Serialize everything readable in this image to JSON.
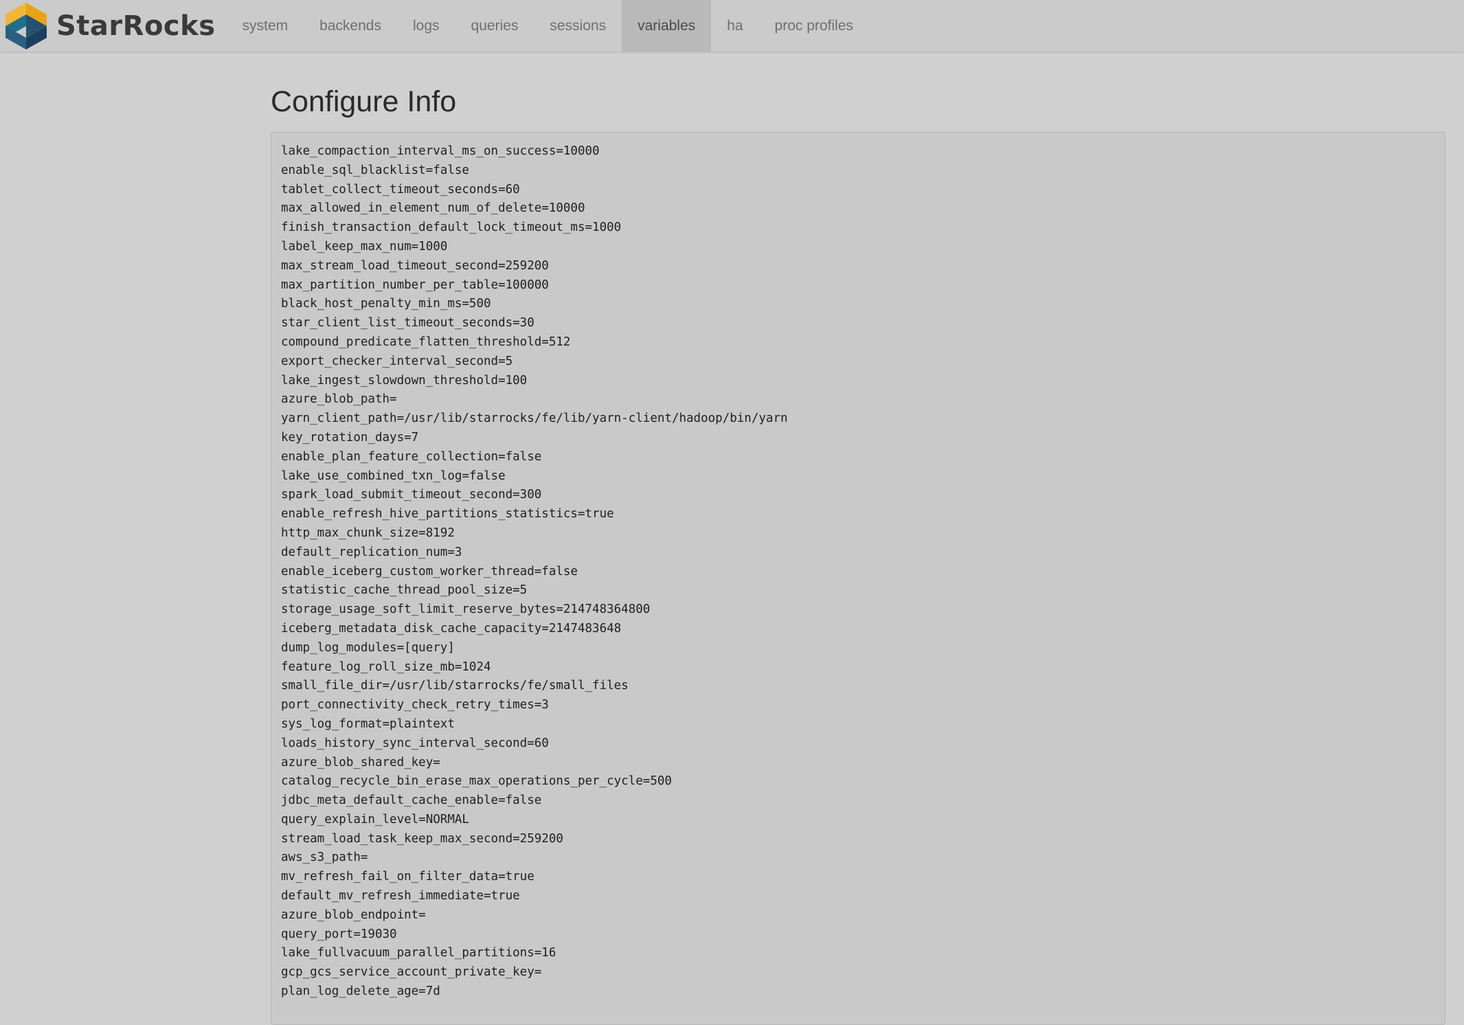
{
  "brand": {
    "name": "StarRocks",
    "colors": {
      "gold": "#e8a317",
      "teal": "#1f6f8b",
      "navy": "#1b3f5e"
    }
  },
  "nav": {
    "items": [
      {
        "label": "system",
        "active": false
      },
      {
        "label": "backends",
        "active": false
      },
      {
        "label": "logs",
        "active": false
      },
      {
        "label": "queries",
        "active": false
      },
      {
        "label": "sessions",
        "active": false
      },
      {
        "label": "variables",
        "active": true
      },
      {
        "label": "ha",
        "active": false
      },
      {
        "label": "proc profiles",
        "active": false
      }
    ]
  },
  "main": {
    "title": "Configure Info",
    "config_lines": [
      "lake_compaction_interval_ms_on_success=10000",
      "enable_sql_blacklist=false",
      "tablet_collect_timeout_seconds=60",
      "max_allowed_in_element_num_of_delete=10000",
      "finish_transaction_default_lock_timeout_ms=1000",
      "label_keep_max_num=1000",
      "max_stream_load_timeout_second=259200",
      "max_partition_number_per_table=100000",
      "black_host_penalty_min_ms=500",
      "star_client_list_timeout_seconds=30",
      "compound_predicate_flatten_threshold=512",
      "export_checker_interval_second=5",
      "lake_ingest_slowdown_threshold=100",
      "azure_blob_path=",
      "yarn_client_path=/usr/lib/starrocks/fe/lib/yarn-client/hadoop/bin/yarn",
      "key_rotation_days=7",
      "enable_plan_feature_collection=false",
      "lake_use_combined_txn_log=false",
      "spark_load_submit_timeout_second=300",
      "enable_refresh_hive_partitions_statistics=true",
      "http_max_chunk_size=8192",
      "default_replication_num=3",
      "enable_iceberg_custom_worker_thread=false",
      "statistic_cache_thread_pool_size=5",
      "storage_usage_soft_limit_reserve_bytes=214748364800",
      "iceberg_metadata_disk_cache_capacity=2147483648",
      "dump_log_modules=[query]",
      "feature_log_roll_size_mb=1024",
      "small_file_dir=/usr/lib/starrocks/fe/small_files",
      "port_connectivity_check_retry_times=3",
      "sys_log_format=plaintext",
      "loads_history_sync_interval_second=60",
      "azure_blob_shared_key=",
      "catalog_recycle_bin_erase_max_operations_per_cycle=500",
      "jdbc_meta_default_cache_enable=false",
      "query_explain_level=NORMAL",
      "stream_load_task_keep_max_second=259200",
      "aws_s3_path=",
      "mv_refresh_fail_on_filter_data=true",
      "default_mv_refresh_immediate=true",
      "azure_blob_endpoint=",
      "query_port=19030",
      "lake_fullvacuum_parallel_partitions=16",
      "gcp_gcs_service_account_private_key=",
      "plan_log_delete_age=7d"
    ]
  }
}
